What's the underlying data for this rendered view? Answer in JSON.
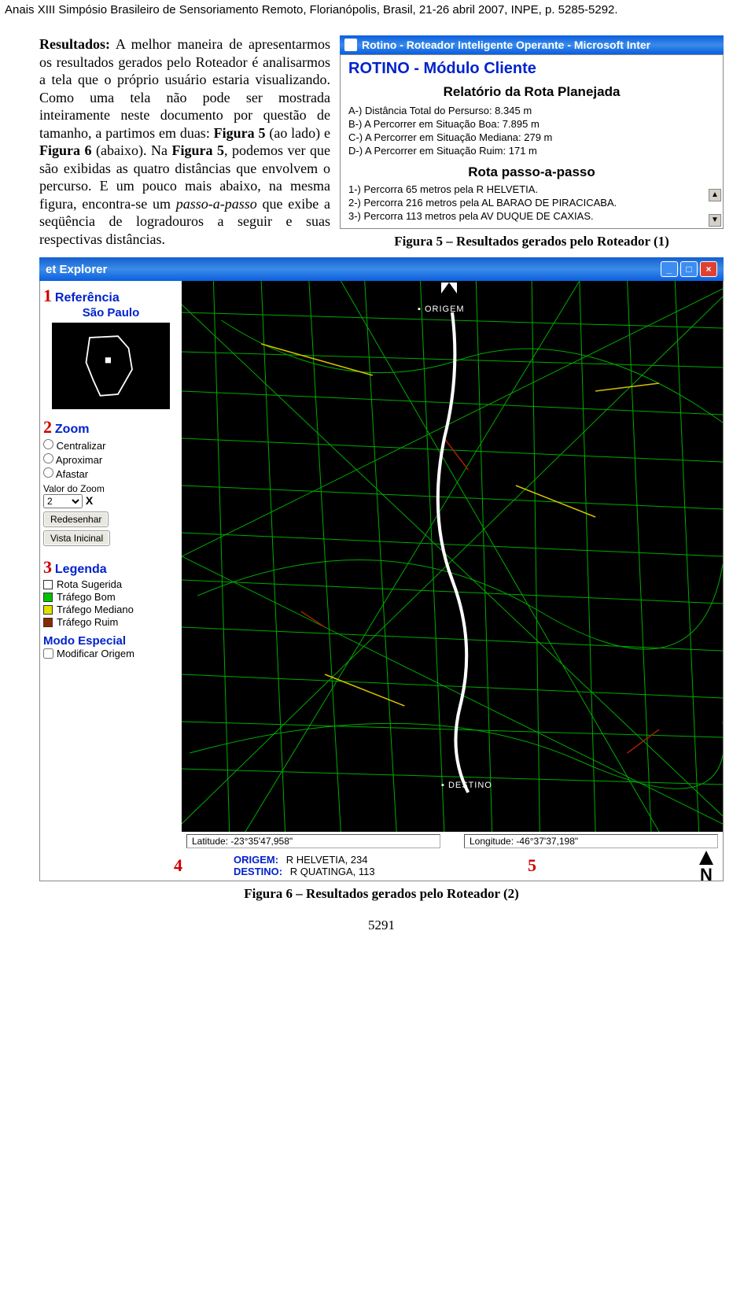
{
  "header": "Anais XIII Simpósio Brasileiro de Sensoriamento Remoto, Florianópolis, Brasil, 21-26 abril 2007, INPE, p. 5285-5292.",
  "paragraph": {
    "lead": "Resultados:",
    "body1": " A melhor maneira de apresentarmos os resultados gerados pelo Roteador é analisarmos a tela que o próprio usuário estaria visualizando. Como uma tela não pode ser mostrada inteiramente neste documento por questão de tamanho, a partimos em duas: ",
    "fig5": "Figura 5",
    "body2": " (ao lado) e ",
    "fig6": "Figura 6",
    "body3": " (abaixo). Na ",
    "fig5b": "Figura 5",
    "body4": ", podemos ver que são exibidas as quatro distâncias que envolvem o percurso. E um pouco mais abaixo, na mesma figura, encontra-se um ",
    "passo": "passo-a-passo",
    "body5": " que exibe a seqüência de logradouros a seguir e suas respectivas distâncias."
  },
  "figure5": {
    "win_title": "Rotino - Roteador Inteligente Operante - Microsoft Inter",
    "title": "ROTINO - Módulo Cliente",
    "sub": "Relatório da Rota Planejada",
    "lines": [
      "A-) Distância Total do Persurso: 8.345 m",
      "B-) A Percorrer em Situação Boa: 7.895 m",
      "C-) A Percorrer em Situação Mediana: 279 m",
      "D-) A Percorrer em Situação Ruim: 171 m"
    ],
    "rota_sub": "Rota passo-a-passo",
    "steps": [
      "1-) Percorra 65 metros pela R HELVETIA.",
      "2-) Percorra 216 metros pela AL BARAO DE PIRACICABA.",
      "3-) Percorra 113 metros pela AV DUQUE DE CAXIAS."
    ],
    "caption": "Figura 5 – Resultados gerados pelo Roteador (1)"
  },
  "figure6": {
    "ie_title": "et Explorer",
    "panel1_num": "1",
    "panel1_title": "Referência",
    "panel1_sub": "São Paulo",
    "panel2_num": "2",
    "panel2_title": "Zoom",
    "zoom_opts": [
      "Centralizar",
      "Aproximar",
      "Afastar"
    ],
    "zoom_val_label": "Valor do Zoom",
    "zoom_val": "2",
    "zoom_x": "X",
    "btn_redesenhar": "Redesenhar",
    "btn_vista": "Vista Inicinal",
    "panel3_num": "3",
    "panel3_title": "Legenda",
    "legend": [
      {
        "color": "#ffffff",
        "label": "Rota Sugerida"
      },
      {
        "color": "#00c400",
        "label": "Tráfego Bom"
      },
      {
        "color": "#e0e000",
        "label": "Tráfego Mediano"
      },
      {
        "color": "#8b2a00",
        "label": "Tráfego Ruim"
      }
    ],
    "modo_title": "Modo Especial",
    "modo_opt": "Modificar Origem",
    "num4": "4",
    "num5": "5",
    "lat_label": "Latitude:",
    "lat_val": "-23°35'47,958\"",
    "lon_label": "Longitude:",
    "lon_val": "-46°37'37,198\"",
    "origem_label": "ORIGEM:",
    "origem_val": "R HELVETIA, 234",
    "destino_label": "DESTINO:",
    "destino_val": "R QUATINGA, 113",
    "compass": "N",
    "map_origem": "ORIGEM",
    "map_destino": "DESTINO",
    "caption": "Figura 6 – Resultados gerados pelo Roteador (2)"
  },
  "page_num": "5291"
}
